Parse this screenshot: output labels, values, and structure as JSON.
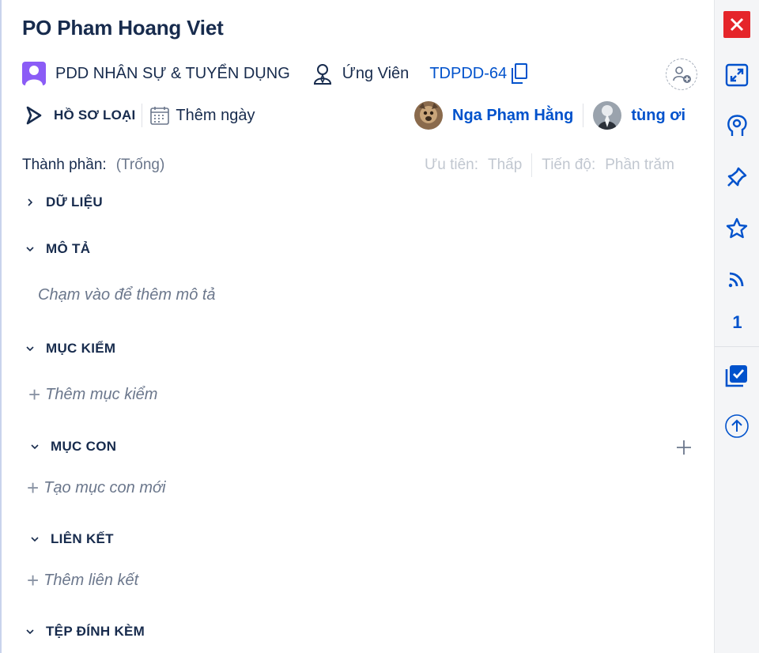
{
  "issue": {
    "title": "PO Pham Hoang Viet",
    "project_name": "PDD NHÂN SỰ & TUYỂN DỤNG",
    "issue_type": "Ứng Viên",
    "key": "TDPDD-64",
    "status": "HỒ SƠ LOẠI",
    "due_date_placeholder": "Thêm ngày"
  },
  "people": [
    {
      "name": "Nga Phạm Hằng"
    },
    {
      "name": "tùng ơi"
    }
  ],
  "fields": {
    "component_label": "Thành phần:",
    "component_value": "(Trống)",
    "priority_label": "Ưu tiên:",
    "priority_value": "Thấp",
    "progress_label": "Tiến độ:",
    "progress_value": "Phần trăm"
  },
  "sections": {
    "data": {
      "label": "DỮ LIỆU"
    },
    "description": {
      "label": "MÔ TẢ",
      "placeholder": "Chạm vào để thêm mô tả"
    },
    "checklist": {
      "label": "MỤC KIỂM",
      "placeholder": "Thêm mục kiểm"
    },
    "subtasks": {
      "label": "MỤC CON",
      "placeholder": "Tạo mục con mới"
    },
    "links": {
      "label": "LIÊN KẾT",
      "placeholder": "Thêm liên kết"
    },
    "attachments": {
      "label": "TỆP ĐÍNH KÈM"
    }
  },
  "rail": {
    "count": "1",
    "icons": [
      "close-icon",
      "expand-icon",
      "brain-icon",
      "pin-icon",
      "star-icon",
      "rss-icon",
      "checkbox-icon",
      "arrow-up-icon"
    ]
  },
  "colors": {
    "close": "#e5252a",
    "accent": "#0052cc",
    "project_icon": "#8b5cf6",
    "text": "#172b4d",
    "muted": "#6b778c"
  }
}
